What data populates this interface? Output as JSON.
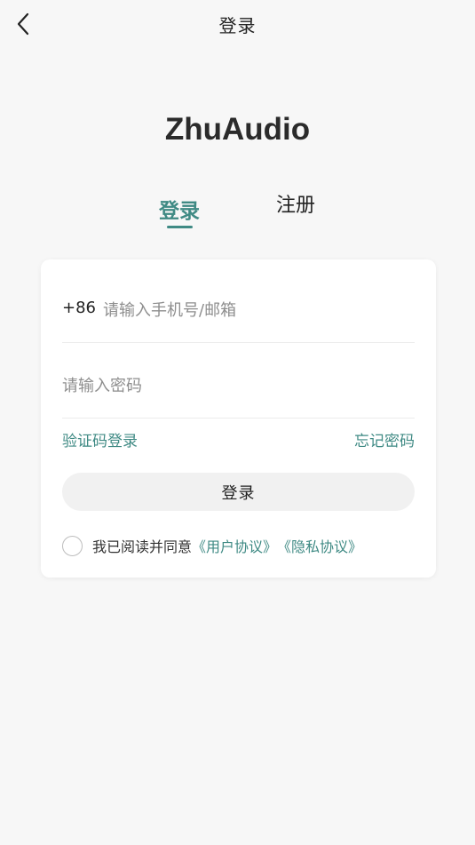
{
  "nav": {
    "title": "登录",
    "back_icon": "chevron-left-icon"
  },
  "brand": {
    "name": "ZhuAudio"
  },
  "tabs": [
    {
      "label": "登录",
      "active": true
    },
    {
      "label": "注册",
      "active": false
    }
  ],
  "form": {
    "country_code": "+86",
    "phone_placeholder": "请输入手机号/邮箱",
    "phone_value": "",
    "password_placeholder": "请输入密码",
    "password_value": "",
    "sms_login_label": "验证码登录",
    "forgot_password_label": "忘记密码",
    "submit_label": "登录"
  },
  "agreement": {
    "checked": false,
    "prefix": "我已阅读并同意",
    "user_agreement": "《用户协议》",
    "privacy_policy": "《隐私协议》"
  },
  "colors": {
    "accent": "#3f8a84",
    "background": "#f7f7f7",
    "card": "#ffffff",
    "button_bg": "#f1f1f1"
  }
}
